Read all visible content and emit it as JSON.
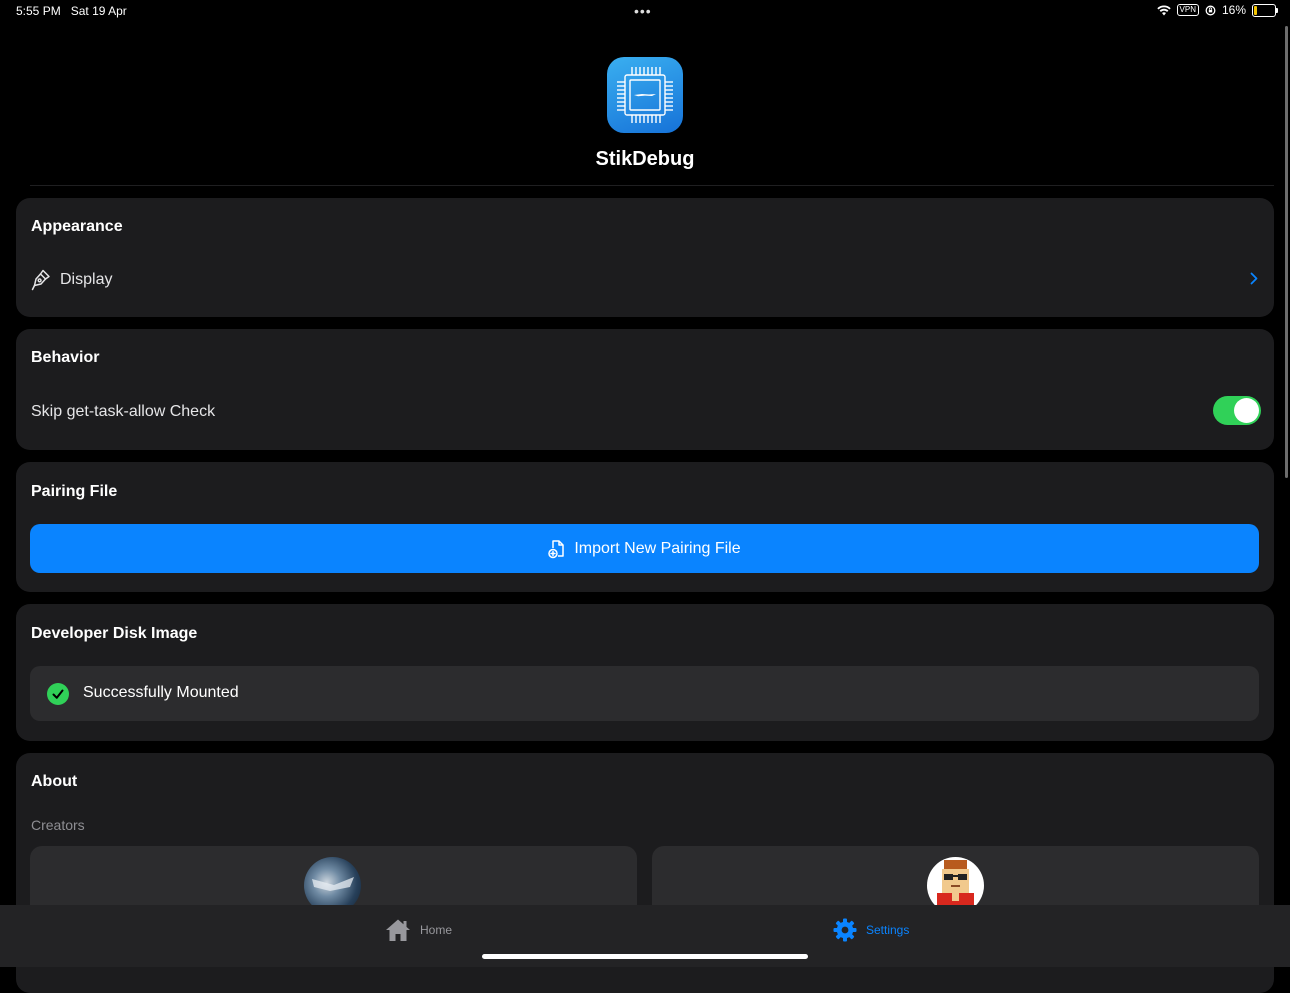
{
  "status_bar": {
    "time": "5:55 PM",
    "date": "Sat 19 Apr",
    "multitask_dots": "•••",
    "vpn_badge": "VPN",
    "battery_percent": "16%",
    "battery_level": 0.16
  },
  "header": {
    "app_name": "StikDebug",
    "app_icon": "chip-icon"
  },
  "appearance": {
    "title": "Appearance",
    "display_label": "Display",
    "display_icon": "paintbrush-pointed-icon"
  },
  "behavior": {
    "title": "Behavior",
    "skip_check_label": "Skip get-task-allow Check",
    "skip_check_enabled": true
  },
  "pairing": {
    "title": "Pairing File",
    "import_label": "Import New Pairing File",
    "import_icon": "doc-badge-plus-icon"
  },
  "ddi": {
    "title": "Developer Disk Image",
    "status_label": "Successfully Mounted",
    "status_icon": "checkmark-circle-icon"
  },
  "about": {
    "title": "About",
    "creators_label": "Creators"
  },
  "tabs": [
    {
      "label": "Home",
      "icon": "house-icon",
      "selected": false
    },
    {
      "label": "Settings",
      "icon": "gear-icon",
      "selected": true
    }
  ],
  "colors": {
    "background": "#000000",
    "card": "#1c1c1e",
    "accent": "#0a84ff",
    "toggle_on": "#30d158",
    "success": "#30d158"
  }
}
